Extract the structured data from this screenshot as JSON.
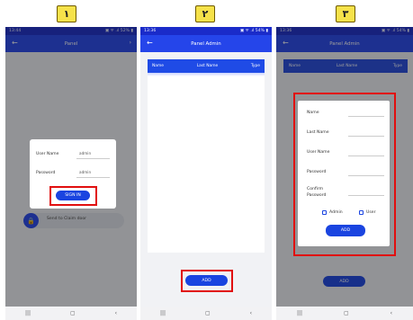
{
  "steps": [
    "١",
    "٢",
    "٣"
  ],
  "status": {
    "p1_time": "13:44",
    "p1_icons": "▣ ᯤ .ıl 52% ▮",
    "p2_time": "13:36",
    "p2_icons": "▣ ᯤ .ıl 54% ▮",
    "p3_time": "13:36",
    "p3_icons": "▣ ᯤ .ıl 54% ▮"
  },
  "titles": {
    "p1": "Panel",
    "p2": "Panel Admin",
    "p3": "Panel Admin"
  },
  "login": {
    "username_label": "User Name",
    "username_value": "admin",
    "password_label": "Password",
    "password_value": "admin",
    "sign_in": "SIGN IN",
    "send_code": "Send to Claim door"
  },
  "table": {
    "columns": [
      "Name",
      "Last Name",
      "Type"
    ]
  },
  "add_button": "ADD",
  "form": {
    "name": "Name",
    "last_name": "Last Name",
    "user_name": "User Name",
    "password": "Password",
    "confirm_line1": "Confirm",
    "confirm_line2": "Password",
    "admin": "Admin",
    "user": "User",
    "add": "ADD"
  },
  "navbar": [
    "|||",
    "▢",
    "‹"
  ],
  "colors": {
    "accent": "#2545ea",
    "status": "#1a2bc9",
    "highlight": "#e10e0e",
    "badge": "#f6e24a"
  },
  "icons": {
    "back": "arrow-left-icon",
    "lock": "lock-icon"
  }
}
